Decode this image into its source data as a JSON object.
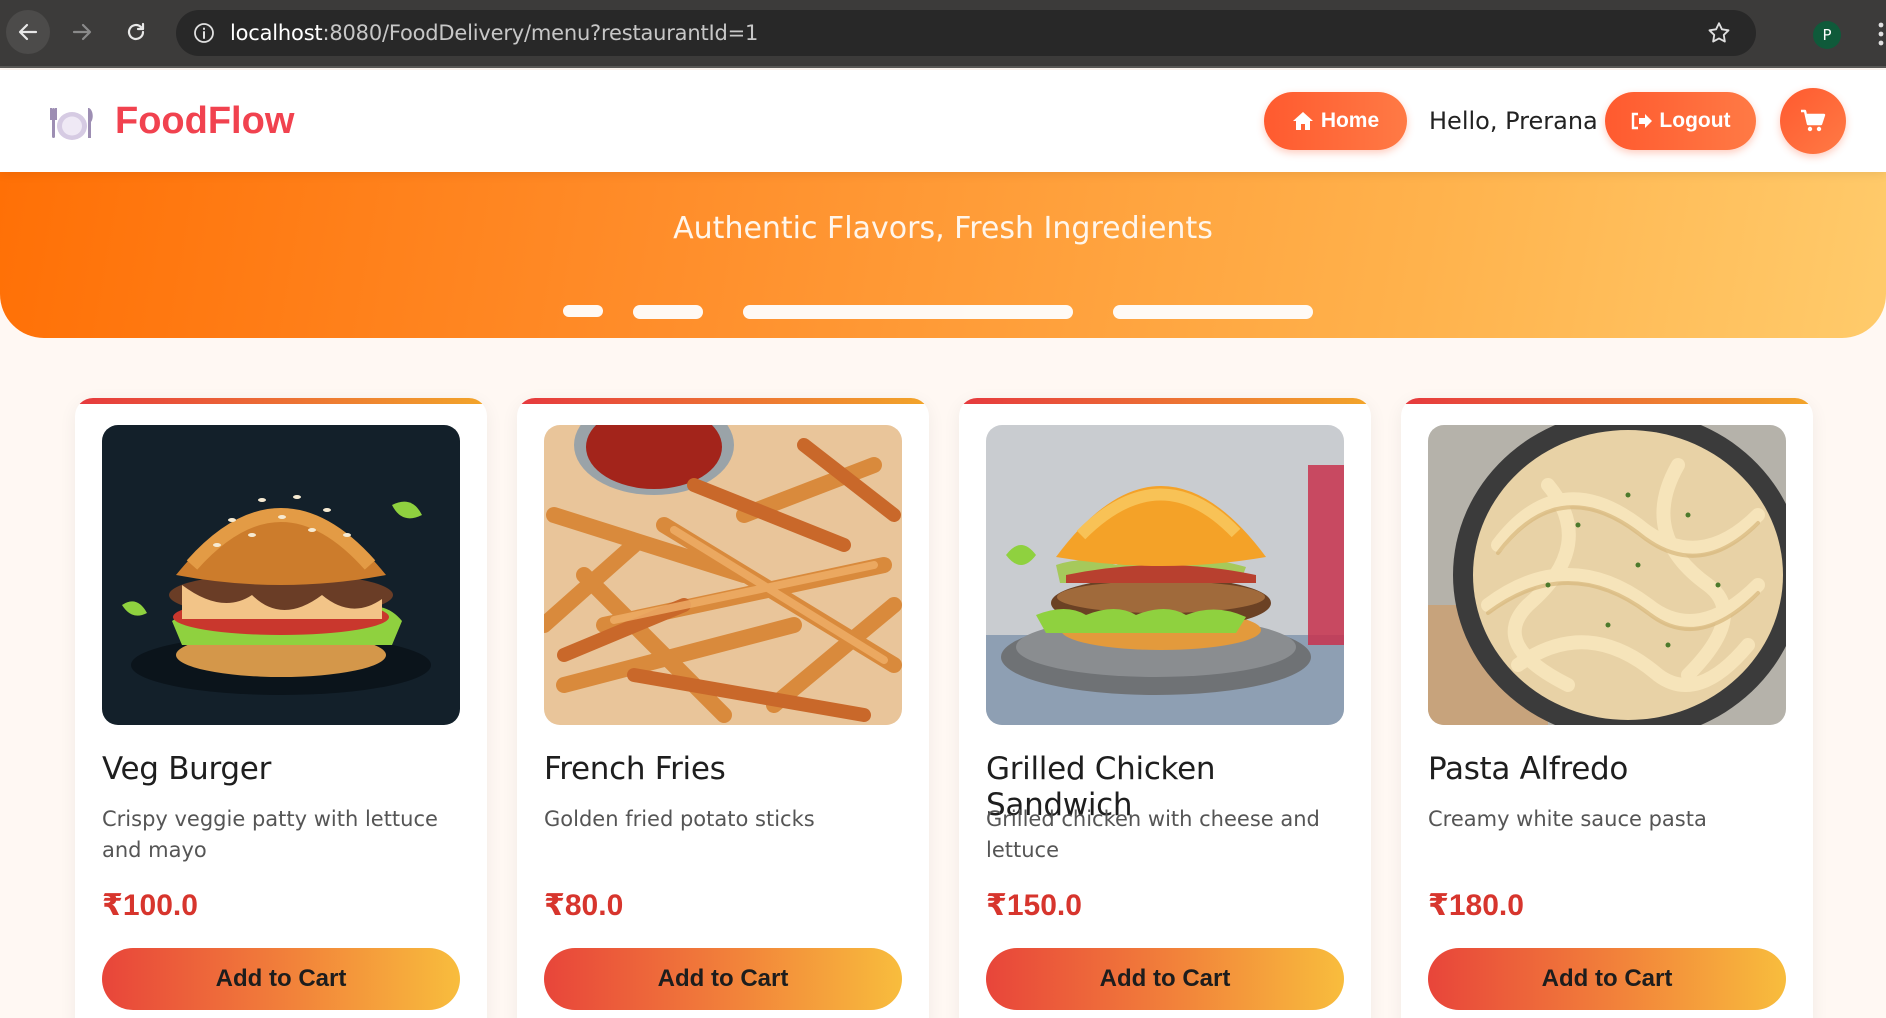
{
  "browser": {
    "url_host": "localhost",
    "url_rest": ":8080/FoodDelivery/menu?restaurantId=1",
    "profile_initial": "P"
  },
  "header": {
    "brand": "FoodFlow",
    "home_label": "Home",
    "greeting": "Hello, Prerana",
    "logout_label": "Logout"
  },
  "hero": {
    "subtitle": "Authentic Flavors, Fresh Ingredients"
  },
  "menu": {
    "items": [
      {
        "name": "Veg Burger",
        "description": "Crispy veggie patty with lettuce and mayo",
        "price": "₹100.0",
        "button": "Add to Cart"
      },
      {
        "name": "French Fries",
        "description": "Golden fried potato sticks",
        "price": "₹80.0",
        "button": "Add to Cart"
      },
      {
        "name": "Grilled Chicken Sandwich",
        "description": "Grilled chicken with cheese and lettuce",
        "price": "₹150.0",
        "button": "Add to Cart"
      },
      {
        "name": "Pasta Alfredo",
        "description": "Creamy white sauce pasta",
        "price": "₹180.0",
        "button": "Add to Cart"
      }
    ]
  },
  "colors": {
    "brand": "#f1424f",
    "accent": "#ff5a2f",
    "price": "#d7352d"
  }
}
